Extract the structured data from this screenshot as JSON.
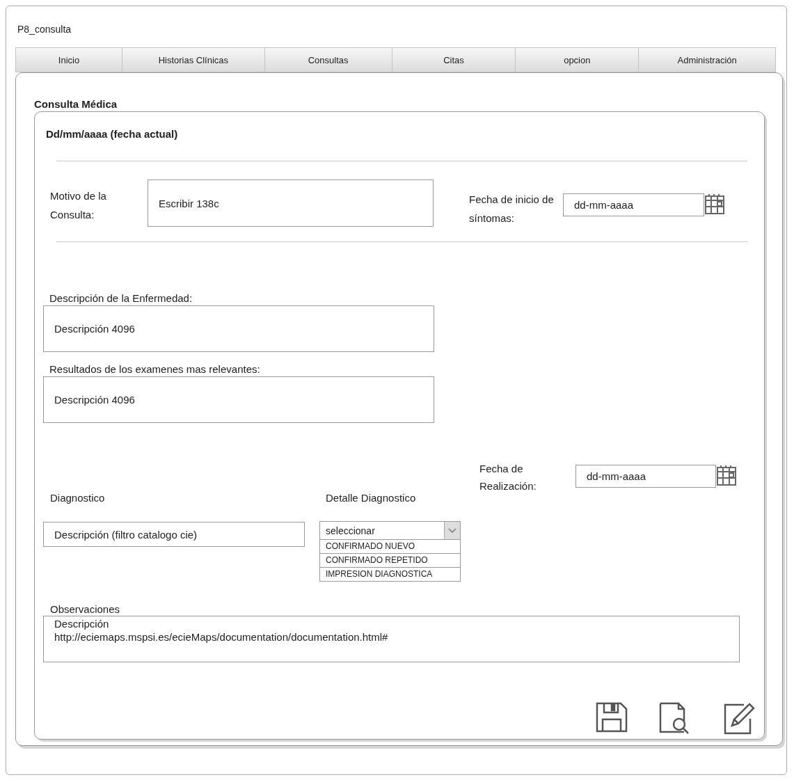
{
  "window": {
    "title": "P8_consulta"
  },
  "tabs": [
    {
      "label": "Inicio",
      "selected": false
    },
    {
      "label": "Historias Clínicas",
      "selected": false
    },
    {
      "label": "Consultas",
      "selected": false
    },
    {
      "label": "Citas",
      "selected": false
    },
    {
      "label": "opcion",
      "selected": false
    },
    {
      "label": "Administración",
      "selected": false
    }
  ],
  "section_title": "Consulta Médica",
  "card": {
    "date_heading": "Dd/mm/aaaa (fecha actual)",
    "motivo": {
      "label": "Motivo de la Consulta:",
      "value": "Escribir 138c"
    },
    "fecha_inicio": {
      "label": "Fecha de inicio de síntomas:",
      "value": "dd-mm-aaaa"
    },
    "descripcion": {
      "label": "Descripción de la Enfermedad:",
      "value": "Descripción 4096"
    },
    "resultados": {
      "label": "Resultados de los examenes mas relevantes:",
      "value": "Descripción 4096"
    },
    "diagnostico": {
      "label": "Diagnostico",
      "value": "Descripción (filtro catalogo cie)"
    },
    "detalle": {
      "label": "Detalle Diagnostico",
      "value": "seleccionar",
      "options": [
        "CONFIRMADO NUEVO",
        "CONFIRMADO REPETIDO",
        "IMPRESION DIAGNOSTICA"
      ]
    },
    "fecha_realizacion": {
      "label": "Fecha de Realización:",
      "value": "dd-mm-aaaa"
    },
    "observaciones": {
      "label": "Observaciones",
      "lines": [
        "Descripción",
        "http://eciemaps.mspsi.es/ecieMaps/documentation/documentation.html#"
      ]
    }
  }
}
